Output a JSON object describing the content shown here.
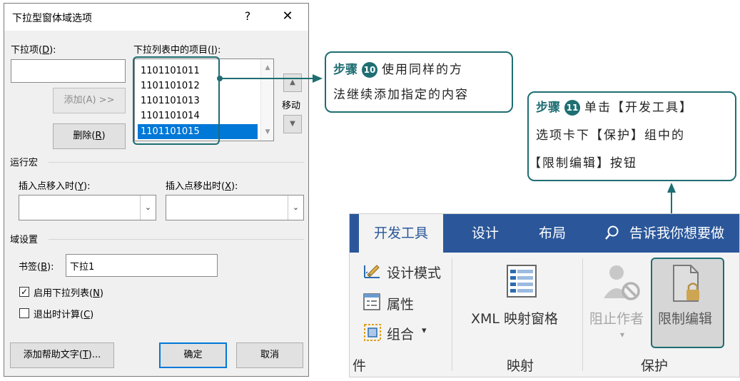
{
  "dialog": {
    "title": "下拉型窗体域选项",
    "help": "?",
    "close": "✕",
    "dropdown_item_label": "下拉项",
    "dropdown_item_key": "D",
    "add_button": "添加(A) >>",
    "remove_button_prefix": "删除(",
    "remove_button_key": "R",
    "remove_button_suffix": ")",
    "list_label_prefix": "下拉列表中的项目(",
    "list_label_key": "I",
    "list_label_suffix": "):",
    "list_items": [
      "1101101011",
      "1101101012",
      "1101101013",
      "1101101014",
      "1101101015"
    ],
    "selected_item": "1101101015",
    "move_label": "移动",
    "run_macro_section": "运行宏",
    "entry_label_prefix": "插入点移入时(",
    "entry_label_key": "Y",
    "entry_label_suffix": "):",
    "exit_label_prefix": "插入点移出时(",
    "exit_label_key": "X",
    "exit_label_suffix": "):",
    "field_settings_section": "域设置",
    "bookmark_label_prefix": "书签(",
    "bookmark_label_key": "B",
    "bookmark_label_suffix": "):",
    "bookmark_value": "下拉1",
    "enable_dropdown_label_prefix": "启用下拉列表(",
    "enable_dropdown_label_key": "N",
    "enable_dropdown_label_suffix": ")",
    "enable_dropdown_checked": true,
    "calc_on_exit_label_prefix": "退出时计算(",
    "calc_on_exit_label_key": "C",
    "calc_on_exit_label_suffix": ")",
    "calc_on_exit_checked": false,
    "help_text_button_prefix": "添加帮助文字(",
    "help_text_button_key": "T",
    "help_text_button_suffix": ")...",
    "ok_button": "确定",
    "cancel_button": "取消"
  },
  "callouts": {
    "step10": {
      "step_word": "步骤",
      "number": "10",
      "line1": "使用同样的方",
      "line2": "法继续添加指定的内容"
    },
    "step11": {
      "step_word": "步骤",
      "number": "11",
      "line1": "单击【开发工具】",
      "line2": "选项卡下【保护】组中的",
      "line3": "【限制编辑】按钮"
    }
  },
  "ribbon": {
    "tabs": [
      "开发工具",
      "设计",
      "布局"
    ],
    "tell_me": "告诉我你想要做",
    "design_mode": "设计模式",
    "properties": "属性",
    "group": "组合",
    "group_arrow": "▾",
    "controls_group_partial": "件",
    "xml_mapping_pane": "XML 映射窗格",
    "mapping_group": "映射",
    "block_authors": "阻止作者",
    "restrict_editing": "限制编辑",
    "protect_group": "保护"
  },
  "colors": {
    "accent": "#1e6e72",
    "ribbon_blue": "#2b579a",
    "selection_blue": "#0078d7"
  }
}
